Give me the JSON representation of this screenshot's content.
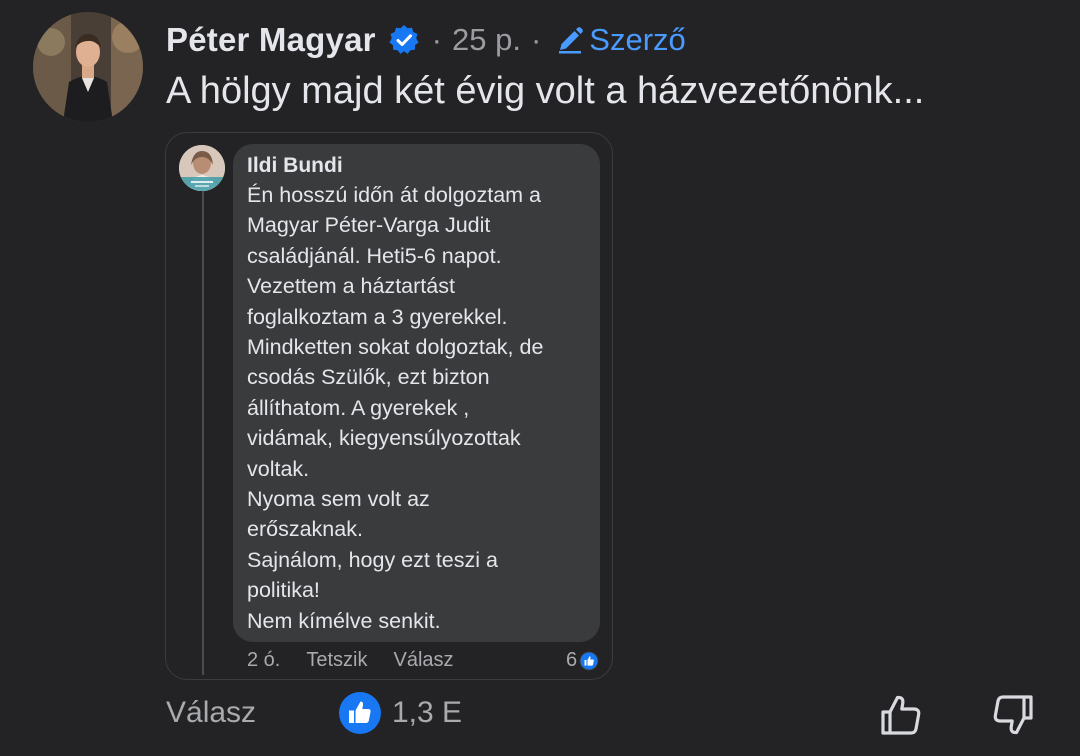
{
  "author": {
    "name": "Péter Magyar",
    "separator": "·",
    "time": "25 p.",
    "role_label": "Szerző"
  },
  "post": {
    "text": "A hölgy majd két évig volt a házvezetőnönk..."
  },
  "shared_comment": {
    "name": "Ildi Bundi",
    "body": "Én hosszú időn át dolgoztam a\nMagyar Péter-Varga Judit\ncsaládjánál. Heti5-6 napot.\nVezettem a háztartást\nfoglalkoztam a 3 gyerekkel.\nMindketten sokat dolgoztak, de\ncsodás Szülők, ezt bizton\nállíthatom. A gyerekek ,\nvidámak, kiegyensúlyozottak\nvoltak.\nNyoma sem volt az\nerőszaknak.\nSajnálom, hogy ezt teszi a\npolitika!\nNem kímélve senkit.",
    "time": "2 ó.",
    "like_label": "Tetszik",
    "reply_label": "Válasz",
    "reaction_count": "6"
  },
  "actions": {
    "reply_label": "Válasz",
    "reaction_count": "1,3 E"
  },
  "icons": {
    "verified": "verified-badge-icon",
    "role": "pencil-icon",
    "like": "like-reaction-icon",
    "upvote": "thumbs-up-outline-icon",
    "downvote": "thumbs-down-outline-icon"
  },
  "colors": {
    "background": "#232325",
    "accent": "#4a9bff",
    "like_blue": "#1877f2",
    "bubble": "#3a3b3d"
  }
}
